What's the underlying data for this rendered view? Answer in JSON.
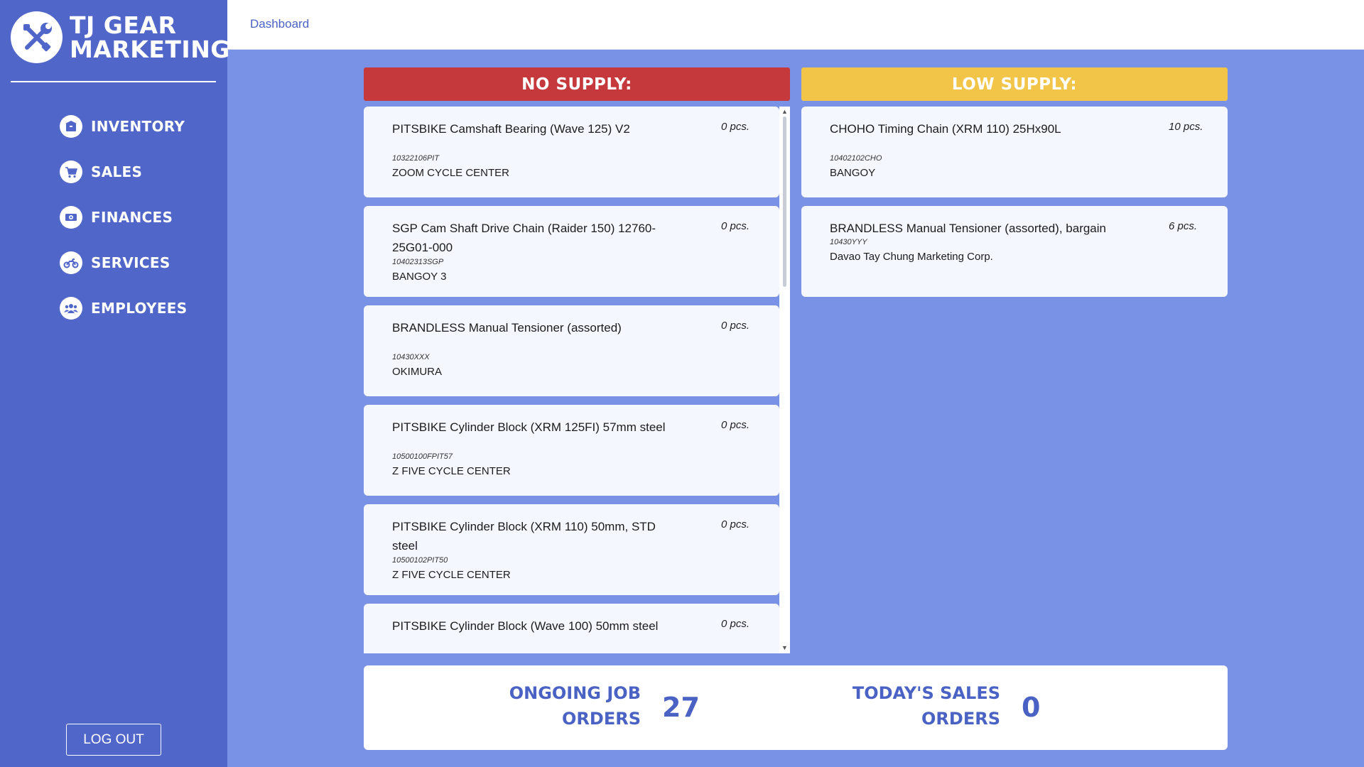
{
  "brand": {
    "line1": "TJ GEAR",
    "line2": "MARKETING"
  },
  "nav": [
    {
      "label": "INVENTORY",
      "icon": "box-icon"
    },
    {
      "label": "SALES",
      "icon": "cart-icon"
    },
    {
      "label": "FINANCES",
      "icon": "money-icon"
    },
    {
      "label": "SERVICES",
      "icon": "motorcycle-icon"
    },
    {
      "label": "EMPLOYEES",
      "icon": "people-icon"
    }
  ],
  "logout_label": "LOG OUT",
  "breadcrumb": "Dashboard",
  "no_supply": {
    "title": "NO SUPPLY:",
    "items": [
      {
        "name": "PITSBIKE Camshaft Bearing (Wave 125) V2",
        "qty": "0 pcs.",
        "code": "10322106PIT",
        "supplier": "ZOOM CYCLE CENTER"
      },
      {
        "name": "SGP Cam Shaft Drive Chain (Raider 150) 12760-25G01-000",
        "qty": "0 pcs.",
        "code": "10402313SGP",
        "supplier": "BANGOY 3"
      },
      {
        "name": "BRANDLESS Manual Tensioner (assorted)",
        "qty": "0 pcs.",
        "code": "10430XXX",
        "supplier": "OKIMURA"
      },
      {
        "name": "PITSBIKE Cylinder Block (XRM 125FI) 57mm steel",
        "qty": "0 pcs.",
        "code": "10500100FPIT57",
        "supplier": "Z FIVE CYCLE CENTER"
      },
      {
        "name": "PITSBIKE Cylinder Block (XRM 110) 50mm, STD steel",
        "qty": "0 pcs.",
        "code": "10500102PIT50",
        "supplier": "Z FIVE CYCLE CENTER"
      },
      {
        "name": "PITSBIKE Cylinder Block (Wave 100) 50mm steel",
        "qty": "0 pcs.",
        "code": "",
        "supplier": ""
      }
    ]
  },
  "low_supply": {
    "title": "LOW SUPPLY:",
    "items": [
      {
        "name": "CHOHO Timing Chain (XRM 110) 25Hx90L",
        "qty": "10 pcs.",
        "code": "10402102CHO",
        "supplier": "BANGOY"
      },
      {
        "name": "BRANDLESS Manual Tensioner (assorted), bargain",
        "qty": "6 pcs.",
        "code": "10430YYY",
        "supplier": "Davao Tay Chung Marketing Corp."
      }
    ]
  },
  "stats": {
    "job_orders_label_1": "ONGOING JOB",
    "job_orders_label_2": "ORDERS",
    "job_orders_value": "27",
    "sales_orders_label_1": "TODAY'S SALES",
    "sales_orders_label_2": "ORDERS",
    "sales_orders_value": "0"
  },
  "colors": {
    "sidebar": "#5066c9",
    "background": "#7a92e6",
    "no_supply": "#c5393c",
    "low_supply": "#f2c548",
    "accent": "#4a62c4"
  }
}
